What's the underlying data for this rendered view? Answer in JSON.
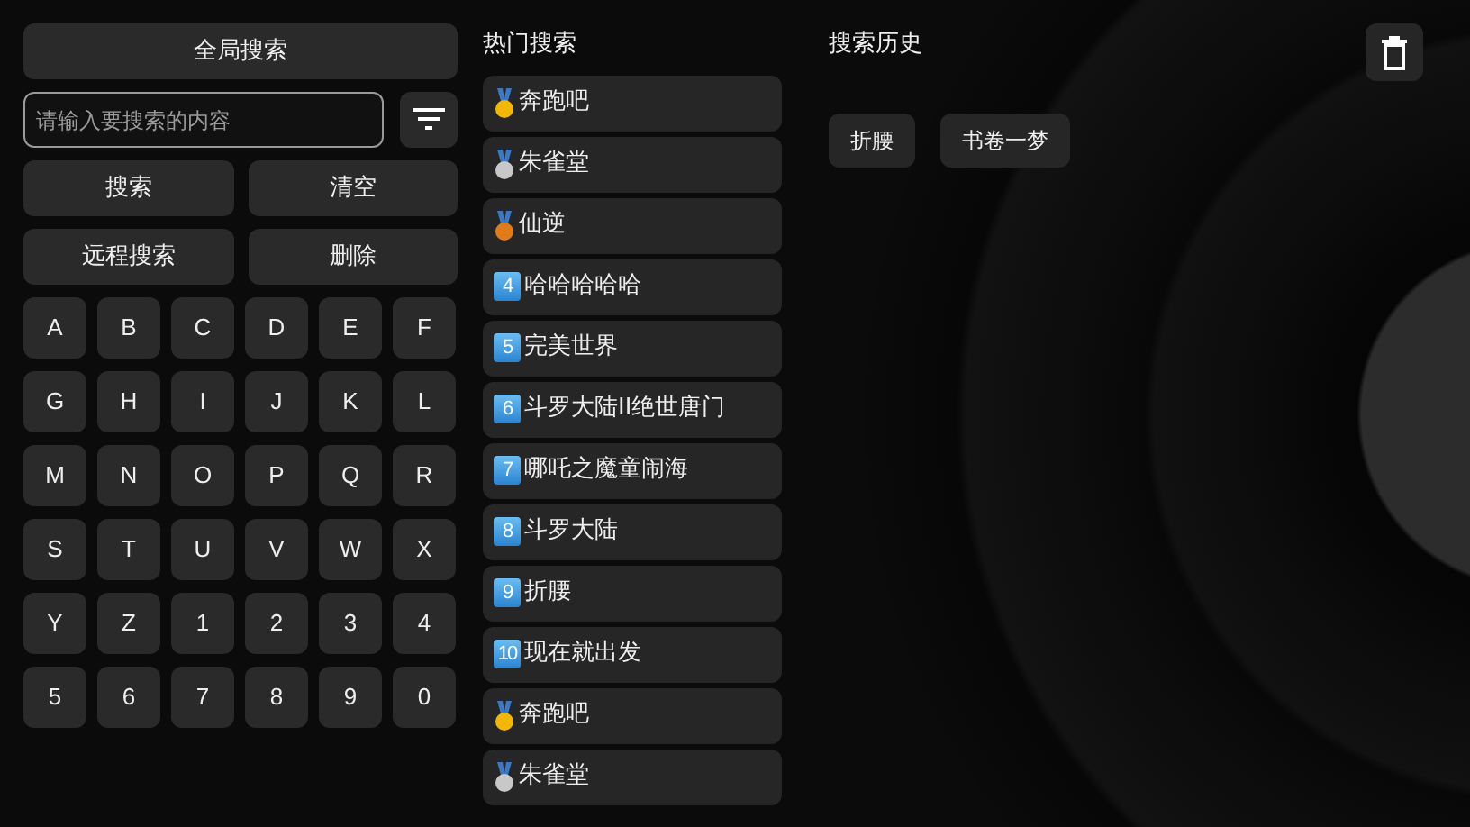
{
  "left_panel": {
    "global_search": "全局搜索",
    "search_field": {
      "placeholder": "请输入要搜索的内容"
    },
    "actions": [
      "搜索",
      "清空",
      "远程搜索",
      "删除"
    ],
    "keys": [
      "A",
      "B",
      "C",
      "D",
      "E",
      "F",
      "G",
      "H",
      "I",
      "J",
      "K",
      "L",
      "M",
      "N",
      "O",
      "P",
      "Q",
      "R",
      "S",
      "T",
      "U",
      "V",
      "W",
      "X",
      "Y",
      "Z",
      "1",
      "2",
      "3",
      "4",
      "5",
      "6",
      "7",
      "8",
      "9",
      "0"
    ]
  },
  "hot_search": {
    "title": "热门搜索",
    "items": [
      {
        "kind": "medal",
        "color": "#f2b705",
        "label": "奔跑吧"
      },
      {
        "kind": "medal",
        "color": "#c8c8c8",
        "label": "朱雀堂"
      },
      {
        "kind": "medal",
        "color": "#e07b1a",
        "label": "仙逆"
      },
      {
        "kind": "keycap",
        "number": "4",
        "label": "哈哈哈哈哈"
      },
      {
        "kind": "keycap",
        "number": "5",
        "label": "完美世界"
      },
      {
        "kind": "keycap",
        "number": "6",
        "label": "斗罗大陆II绝世唐门"
      },
      {
        "kind": "keycap",
        "number": "7",
        "label": "哪吒之魔童闹海"
      },
      {
        "kind": "keycap",
        "number": "8",
        "label": "斗罗大陆"
      },
      {
        "kind": "keycap",
        "number": "9",
        "label": "折腰"
      },
      {
        "kind": "keycap",
        "number": "10",
        "label": "现在就出发"
      },
      {
        "kind": "medal",
        "color": "#f2b705",
        "label": "奔跑吧"
      },
      {
        "kind": "medal",
        "color": "#c8c8c8",
        "label": "朱雀堂"
      }
    ]
  },
  "search_history": {
    "title": "搜索历史",
    "items": [
      "折腰",
      "书卷一梦"
    ]
  }
}
